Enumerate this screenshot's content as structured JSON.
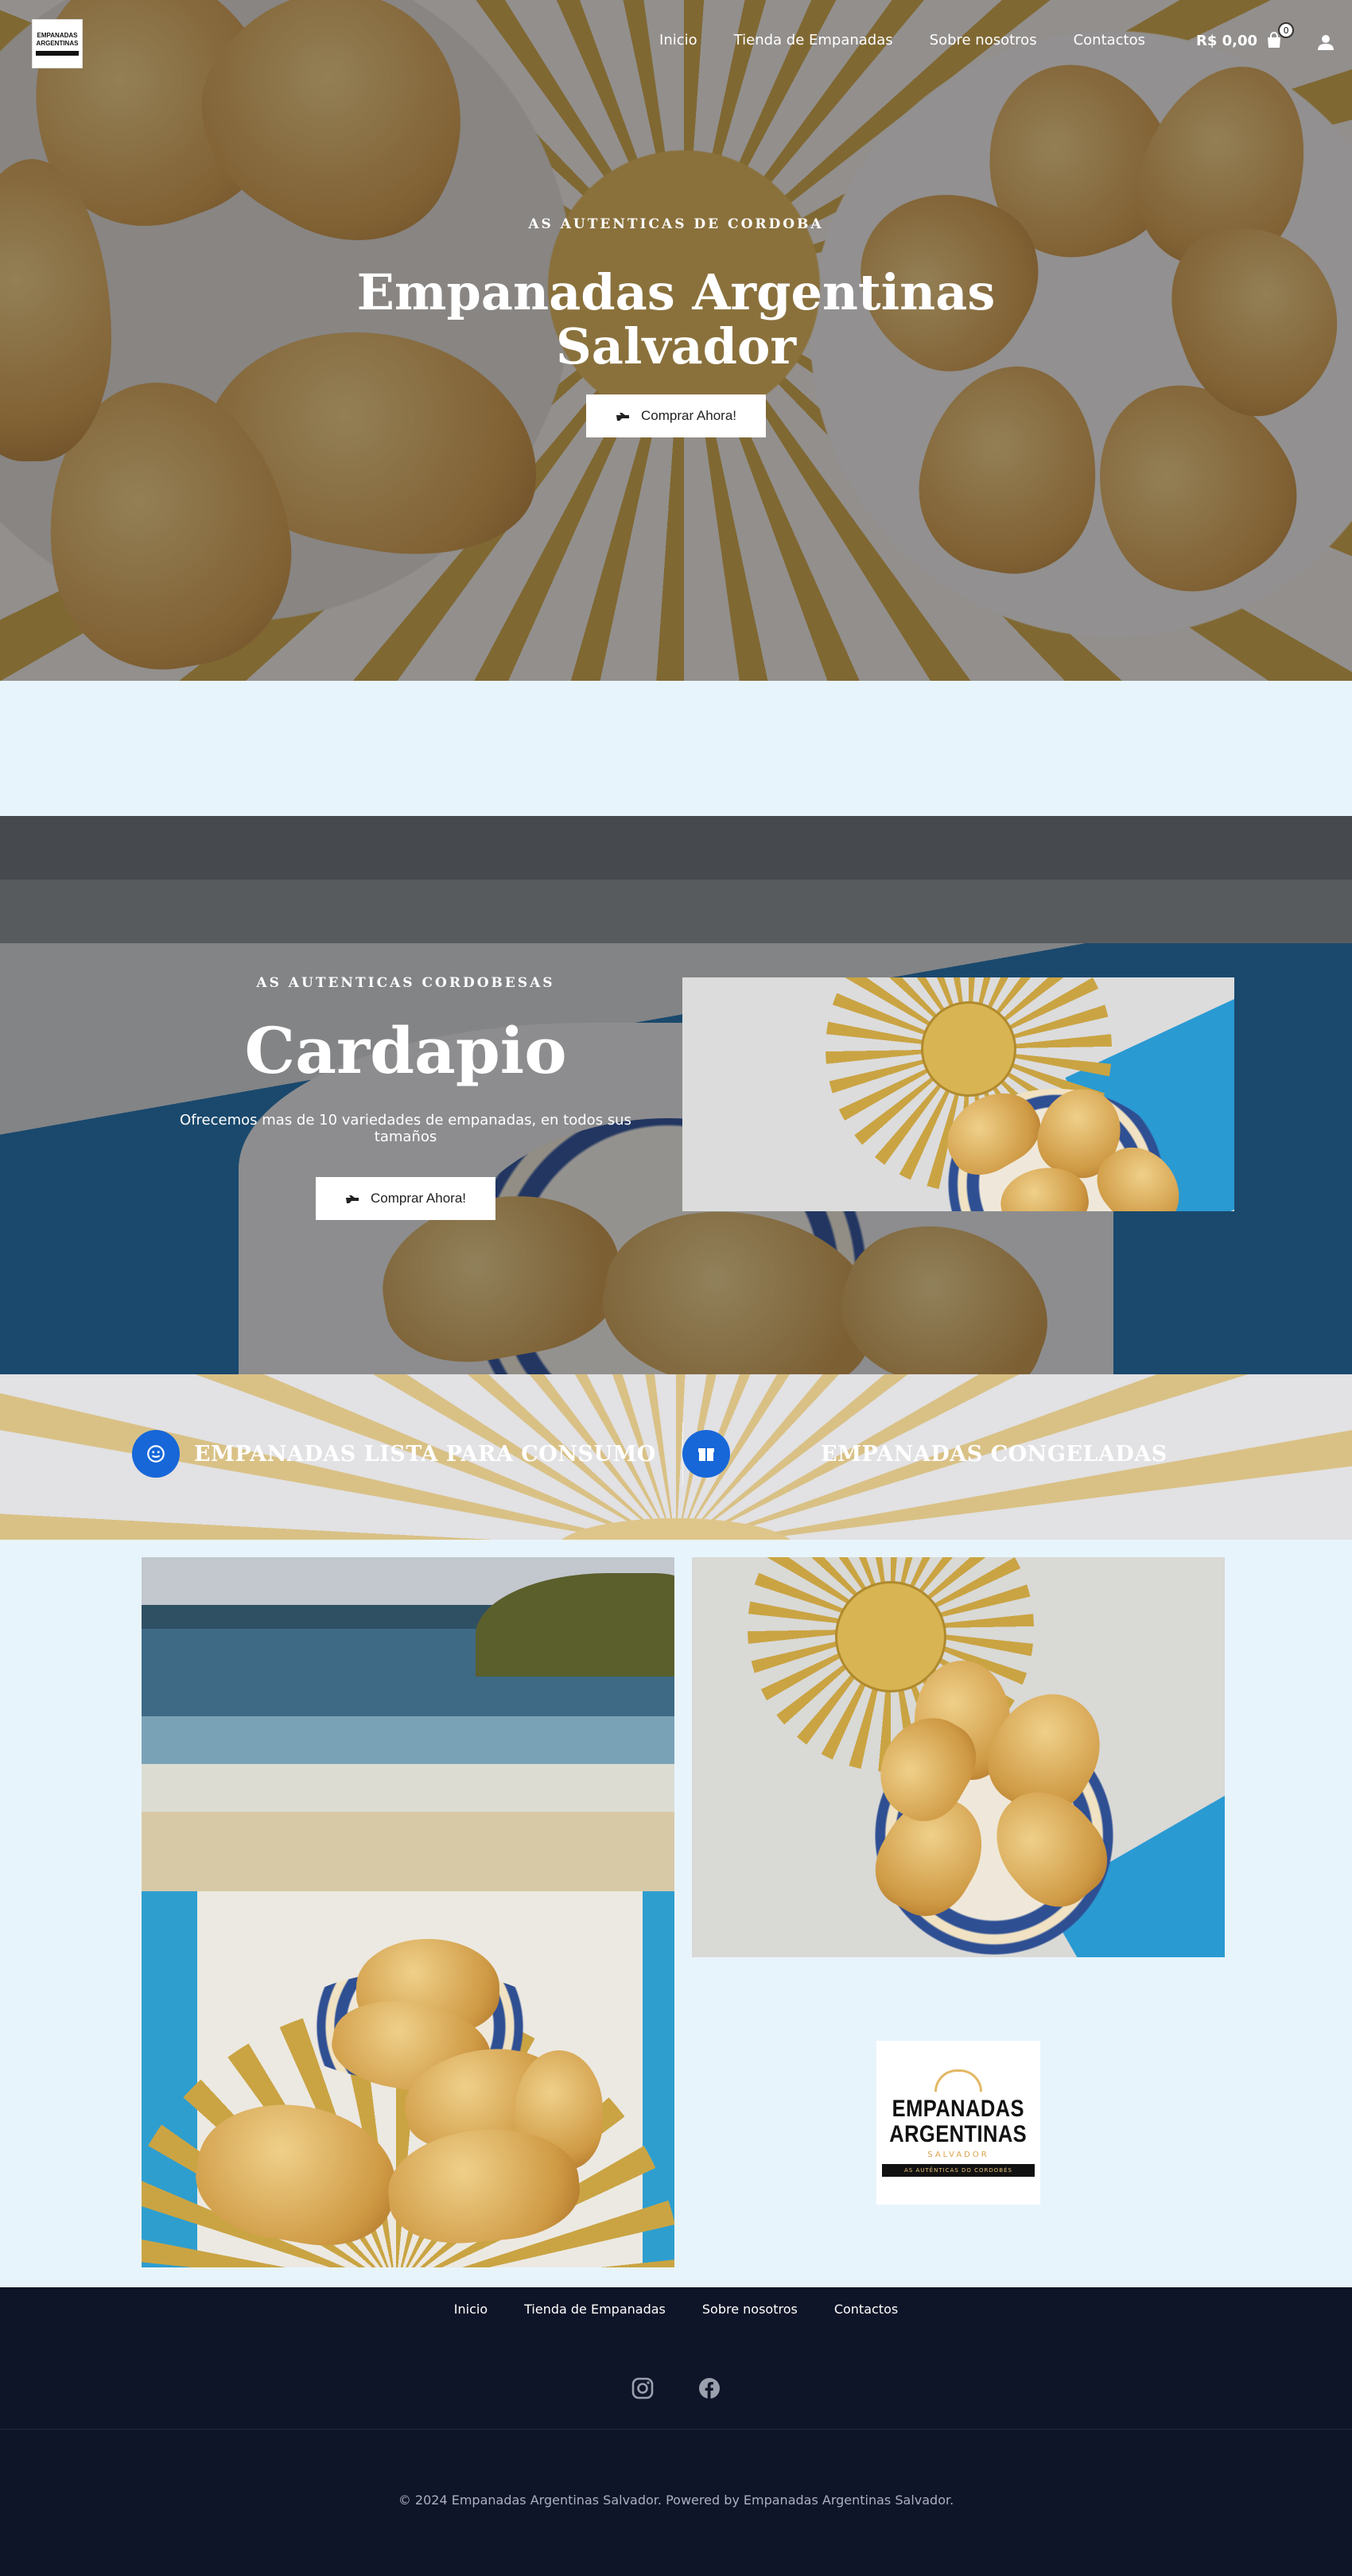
{
  "header": {
    "logo_text": "EMPANADAS ARGENTINAS",
    "nav": [
      "Inicio",
      "Tienda de Empanadas",
      "Sobre nosotros",
      "Contactos"
    ],
    "cart_total": "R$ 0,00",
    "cart_count": "0"
  },
  "hero": {
    "eyebrow": "AS AUTENTICAS DE CORDOBA",
    "title_line1": "Empanadas Argentinas",
    "title_line2": "Salvador",
    "button": "Comprar Ahora!"
  },
  "menu": {
    "eyebrow": "AS AUTENTICAS CORDOBESAS",
    "title": "Cardapio",
    "description": "Ofrecemos mas de 10 variedades de empanadas, en todos sus tamaños",
    "button": "Comprar Ahora!"
  },
  "categories": [
    {
      "label": "EMPANADAS LISTA PARA CONSUMO",
      "icon": "smile-icon"
    },
    {
      "label": "EMPANADAS CONGELADAS",
      "icon": "gift-box-icon"
    }
  ],
  "logo_card": {
    "line1": "EMPANADAS",
    "line2": "ARGENTINAS",
    "city": "SALVADOR",
    "tagline": "AS AUTÊNTICAS DO CORDOBÉS"
  },
  "footer": {
    "nav": [
      "Inicio",
      "Tienda de Empanadas",
      "Sobre nosotros",
      "Contactos"
    ],
    "socials": [
      "instagram-icon",
      "facebook-icon"
    ],
    "copyright": "© 2024 Empanadas Argentinas Salvador. Powered by Empanadas Argentinas Salvador."
  },
  "colors": {
    "page_bg": "#e8f4fc",
    "footer_bg": "#0f1528",
    "accent_blue": "#1767d8",
    "button_bg": "#ffffff"
  }
}
